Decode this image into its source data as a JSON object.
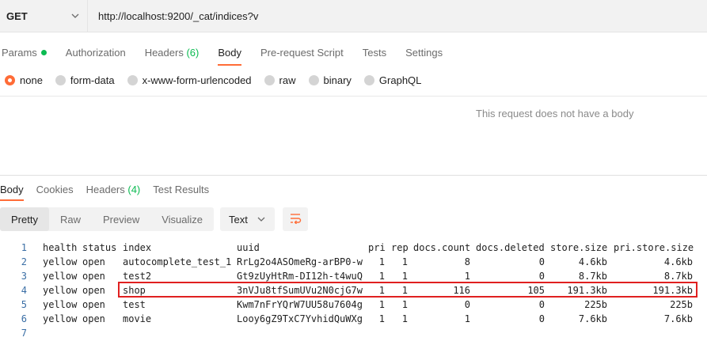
{
  "request": {
    "method": "GET",
    "url": "http://localhost:9200/_cat/indices?v"
  },
  "request_tabs": [
    {
      "label": "Params",
      "active": false
    },
    {
      "label": "Authorization",
      "active": false
    },
    {
      "label": "Headers",
      "count": "(6)",
      "active": false
    },
    {
      "label": "Body",
      "active": true
    },
    {
      "label": "Pre-request Script",
      "active": false
    },
    {
      "label": "Tests",
      "active": false
    },
    {
      "label": "Settings",
      "active": false
    }
  ],
  "body_types": [
    {
      "label": "none",
      "selected": true
    },
    {
      "label": "form-data",
      "selected": false
    },
    {
      "label": "x-www-form-urlencoded",
      "selected": false
    },
    {
      "label": "raw",
      "selected": false
    },
    {
      "label": "binary",
      "selected": false
    },
    {
      "label": "GraphQL",
      "selected": false
    }
  ],
  "no_body_message": "This request does not have a body",
  "response_tabs": [
    {
      "label": "Body",
      "active": true
    },
    {
      "label": "Cookies",
      "active": false
    },
    {
      "label": "Headers",
      "count": "(4)",
      "active": false
    },
    {
      "label": "Test Results",
      "active": false
    }
  ],
  "format_buttons": [
    {
      "label": "Pretty",
      "active": true
    },
    {
      "label": "Raw",
      "active": false
    },
    {
      "label": "Preview",
      "active": false
    },
    {
      "label": "Visualize",
      "active": false
    }
  ],
  "format_select": "Text",
  "colors": {
    "accent": "#ff6c37",
    "green": "#0cbb52",
    "highlight_box": "#e02020"
  },
  "response": {
    "line_numbers": [
      "1",
      "2",
      "3",
      "4",
      "5",
      "6",
      "7"
    ],
    "header": {
      "health": "health",
      "status": "status",
      "index": "index",
      "uuid": "uuid",
      "pri": "pri",
      "rep": "rep",
      "docs_count": "docs.count",
      "docs_deleted": "docs.deleted",
      "store_size": "store.size",
      "pri_store_size": "pri.store.size"
    },
    "rows": [
      {
        "health": "yellow",
        "status": "open",
        "index": "autocomplete_test_1",
        "uuid": "RrLg2o4ASOmeRg-arBP0-w",
        "pri": "1",
        "rep": "1",
        "docs_count": "8",
        "docs_deleted": "0",
        "store_size": "4.6kb",
        "pri_store_size": "4.6kb"
      },
      {
        "health": "yellow",
        "status": "open",
        "index": "test2",
        "uuid": "Gt9zUyHtRm-DI12h-t4wuQ",
        "pri": "1",
        "rep": "1",
        "docs_count": "1",
        "docs_deleted": "0",
        "store_size": "8.7kb",
        "pri_store_size": "8.7kb"
      },
      {
        "health": "yellow",
        "status": "open",
        "index": "shop",
        "uuid": "3nVJu8tfSumUVu2N0cjG7w",
        "pri": "1",
        "rep": "1",
        "docs_count": "116",
        "docs_deleted": "105",
        "store_size": "191.3kb",
        "pri_store_size": "191.3kb"
      },
      {
        "health": "yellow",
        "status": "open",
        "index": "test",
        "uuid": "Kwm7nFrYQrW7UU58u7604g",
        "pri": "1",
        "rep": "1",
        "docs_count": "0",
        "docs_deleted": "0",
        "store_size": "225b",
        "pri_store_size": "225b"
      },
      {
        "health": "yellow",
        "status": "open",
        "index": "movie",
        "uuid": "Looy6gZ9TxC7YvhidQuWXg",
        "pri": "1",
        "rep": "1",
        "docs_count": "1",
        "docs_deleted": "0",
        "store_size": "7.6kb",
        "pri_store_size": "7.6kb"
      }
    ]
  }
}
